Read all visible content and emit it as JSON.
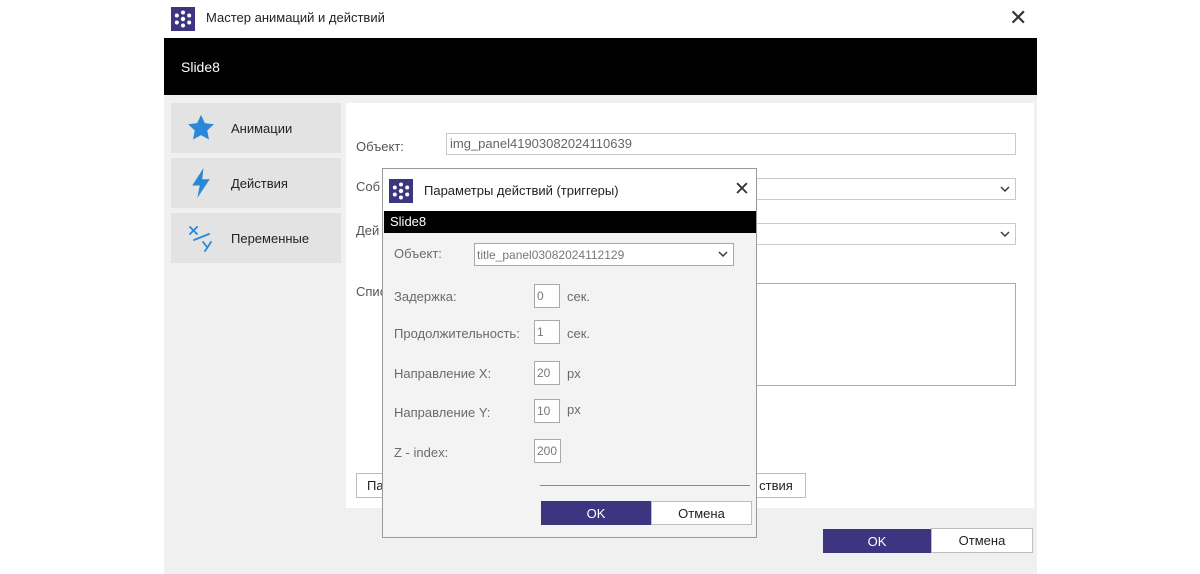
{
  "main": {
    "title": "Мастер анимаций и действий",
    "header": "Slide8",
    "sidebar": [
      {
        "label": "Анимации",
        "icon": "star-icon"
      },
      {
        "label": "Действия",
        "icon": "lightning-icon"
      },
      {
        "label": "Переменные",
        "icon": "variables-icon"
      }
    ],
    "object_label": "Объект:",
    "object_value": "img_panel41903082024110639",
    "event_label_partial": "Соб",
    "action_label_partial": "Дей",
    "list_label_partial": "Спис",
    "btn_left_partial": "Па",
    "btn_right_partial": "ствия",
    "ok": "OK",
    "cancel": "Отмена"
  },
  "dialog": {
    "title": "Параметры действий (триггеры)",
    "header": "Slide8",
    "object_label": "Объект:",
    "object_value": "title_panel03082024112129",
    "delay_label": "Задержка:",
    "delay_value": "0",
    "delay_unit": "сек.",
    "duration_label": "Продолжительность:",
    "duration_value": "1",
    "duration_unit": "сек.",
    "dir_x_label": "Направление X:",
    "dir_x_value": "20",
    "dir_x_unit": "px",
    "dir_y_label": "Направление Y:",
    "dir_y_value": "10",
    "dir_y_unit": "px",
    "z_label": "Z - index:",
    "z_value": "200",
    "ok": "OK",
    "cancel": "Отмена"
  },
  "colors": {
    "accent": "#3d3580",
    "icon_blue": "#2b88d8"
  }
}
